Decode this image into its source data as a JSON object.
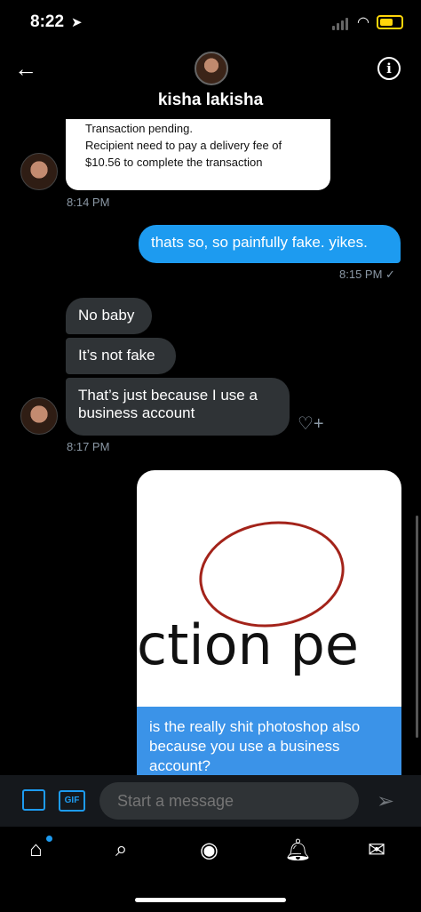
{
  "status_bar": {
    "time": "8:22"
  },
  "header": {
    "contact_name": "kisha lakisha"
  },
  "messages": {
    "card_text": "Transaction pending.\nRecipient need to pay a delivery fee of\n$10.56 to complete the transaction",
    "card_lines": [
      "Transaction pending.",
      "Recipient need to pay a delivery fee of",
      "$10.56 to complete the transaction"
    ],
    "time_1": "8:14 PM",
    "sent_1": "thats so, so painfully fake. yikes.",
    "time_2": "8:15 PM",
    "recv_1": "No baby",
    "recv_2": "It’s not fake",
    "recv_3": "That’s just because I use a business account",
    "time_3": "8:17 PM",
    "image_text": "ction pe",
    "caption": "is the really shit photoshop also because you use a business account?"
  },
  "composer": {
    "placeholder": "Start a message",
    "gif_label": "GIF"
  },
  "icons": {
    "back": "arrow-left-icon",
    "info": "info-icon",
    "image": "image-icon",
    "gif": "gif-icon",
    "send": "send-icon",
    "home": "home-icon",
    "search": "search-icon",
    "spaces": "spaces-icon",
    "notifications": "bell-icon",
    "messages": "mail-icon"
  },
  "colors": {
    "accent": "#1d9bf0",
    "bubble_gray": "#2f3336",
    "annotation_red": "#a3231a"
  }
}
